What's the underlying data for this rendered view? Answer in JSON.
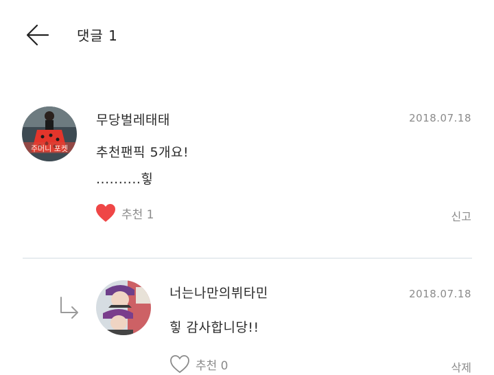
{
  "header": {
    "title": "댓글 1"
  },
  "comments": [
    {
      "author": "무당벌레태태",
      "date": "2018.07.18",
      "lines": [
        "추천팬픽 5개요!",
        "..........힣"
      ],
      "like_label": "추천 1",
      "liked": true,
      "action": "신고",
      "avatar_sign": "주머니 포켓"
    }
  ],
  "reply": {
    "author": "너는나만의뷔타민",
    "date": "2018.07.18",
    "text": "힣 감사합니당!!",
    "like_label": "추천 0",
    "liked": false,
    "action": "삭제"
  },
  "colors": {
    "heart": "#ef4646",
    "muted": "#8a8a8a",
    "divider": "#e7ecef"
  }
}
